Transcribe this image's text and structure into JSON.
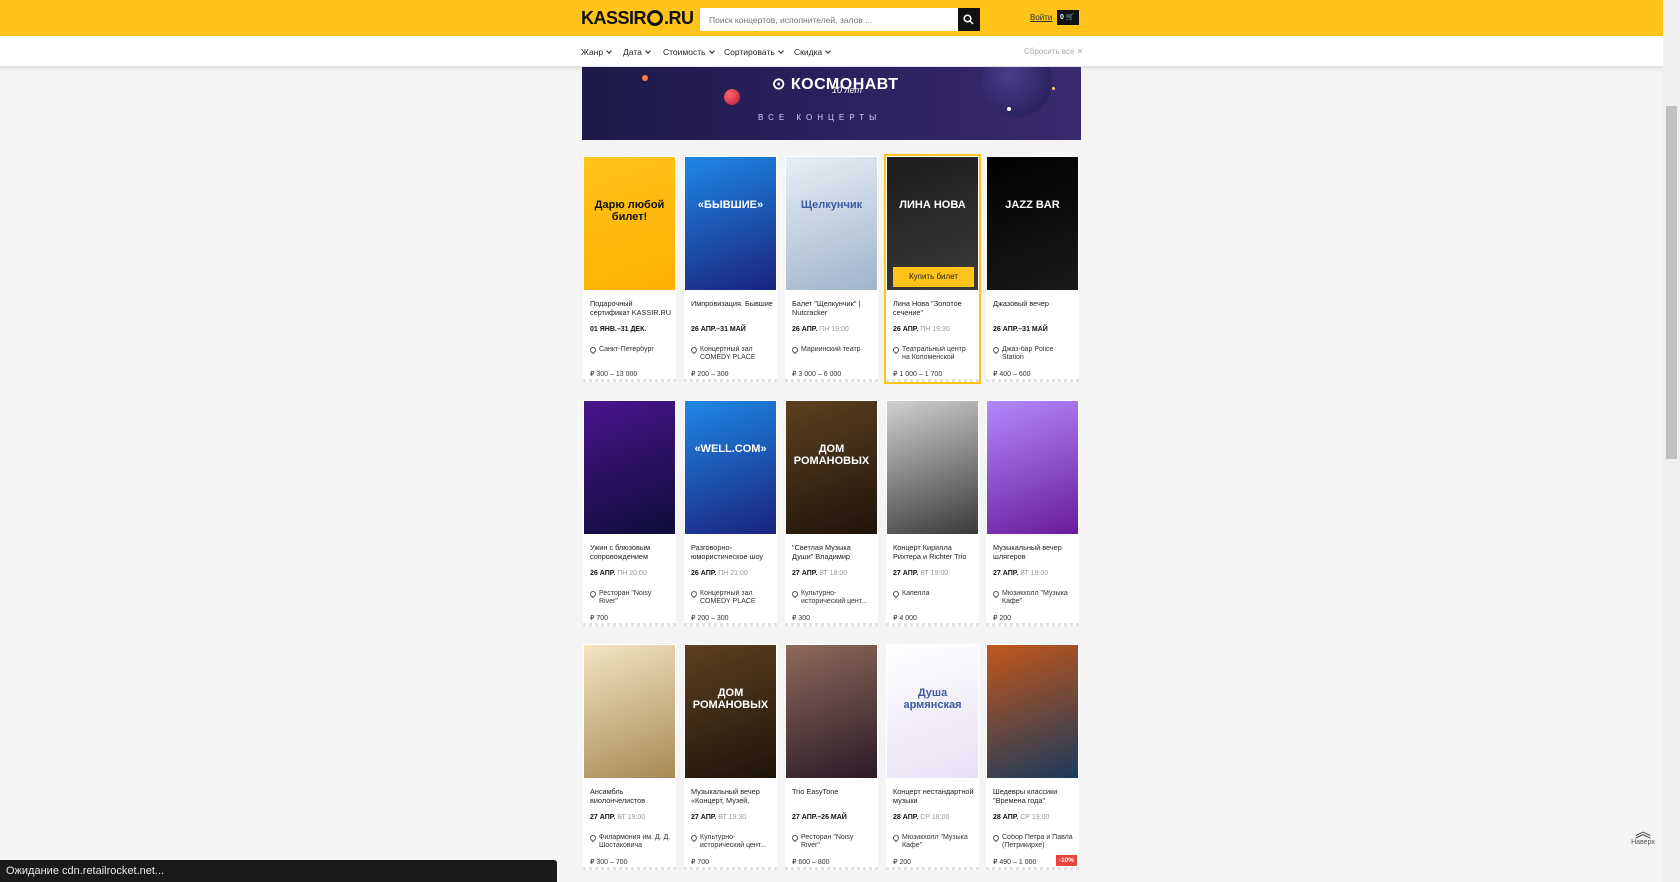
{
  "header": {
    "logo": "KASSIR.RU",
    "logo_left": "KASSIR",
    "logo_right": ".RU",
    "search_placeholder": "Поиск концертов, исполнителей, залов ...",
    "login": "Войти",
    "cart_count": "0"
  },
  "filters": {
    "items": [
      "Жанр",
      "Дата",
      "Стоимость",
      "Сортировать",
      "Скидка"
    ],
    "reset": "Сбросить все"
  },
  "banner": {
    "title": "КОСМОНАВТ",
    "subtitle": "10 лет",
    "link": "ВСЕ КОНЦЕРТЫ"
  },
  "buy_label": "Купить билет",
  "events": [
    {
      "title": "Подарочный сертификат KASSIR.RU",
      "date": "01 ЯНВ.–31 ДЕК.",
      "dow": "",
      "venue": "Санкт-Петербург",
      "price": "₽ 300 – 13 000",
      "img_text": "Дарю любой билет!",
      "colors": [
        "#ffc31a",
        "#ffb000"
      ]
    },
    {
      "title": "Импровизация. Бывшие",
      "date": "26 АПР.–31 МАЙ",
      "dow": "",
      "venue": "Концертный зал COMEDY PLACE",
      "price": "₽ 200 – 300",
      "img_text": "«БЫВШИЕ»",
      "colors": [
        "#1e88e5",
        "#1a237e"
      ]
    },
    {
      "title": "Балет \"Щелкунчик\" | Nutcracker",
      "date": "26 АПР.",
      "dow": "ПН 19:00",
      "venue": "Мариинский театр",
      "price": "₽ 3 000 – 6 000",
      "img_text": "Щелкунчик",
      "colors": [
        "#e8eef5",
        "#9fb4cc"
      ]
    },
    {
      "title": "Лина Нова \"Золотое сечение\"",
      "date": "26 АПР.",
      "dow": "ПН 19:30",
      "venue": "Театральный центр на Коломенской",
      "price": "₽ 1 000 – 1 700",
      "img_text": "ЛИНА НОВА",
      "colors": [
        "#1c1c1c",
        "#3b3b3b"
      ]
    },
    {
      "title": "Джазовый вечер",
      "date": "26 АПР.–31 МАЙ",
      "dow": "",
      "venue": "Джаз-бар Police Station",
      "price": "₽ 400 – 600",
      "img_text": "JAZZ BAR",
      "colors": [
        "#000000",
        "#1a1a1a"
      ]
    },
    {
      "title": "Ужин с блюзовым сопровождением",
      "date": "26 АПР.",
      "dow": "ПН 20:00",
      "venue": "Ресторан \"Noisy River\"",
      "price": "₽ 700",
      "img_text": "",
      "colors": [
        "#4a148c",
        "#0d0d3a"
      ]
    },
    {
      "title": "Разговорно-юмористическое шоу",
      "date": "26 АПР.",
      "dow": "ПН 21:00",
      "venue": "Концертный зал COMEDY PLACE",
      "price": "₽ 200 – 300",
      "img_text": "«WELL.COM»",
      "colors": [
        "#1e88e5",
        "#1a237e"
      ]
    },
    {
      "title": "\"Светлая Музыка Души\" Владимир",
      "date": "27 АПР.",
      "dow": "ВТ 18:00",
      "venue": "Культурно-исторический цент...",
      "price": "₽ 300",
      "img_text": "ДОМ РОМАНОВЫХ",
      "colors": [
        "#5d4020",
        "#1f140a"
      ]
    },
    {
      "title": "Концерт Кирилла Рихтера и Richter Trio",
      "date": "27 АПР.",
      "dow": "ВТ 19:00",
      "venue": "Капелла",
      "price": "₽ 4 000",
      "img_text": "",
      "colors": [
        "#d0d0d0",
        "#3a3a3a"
      ]
    },
    {
      "title": "Музыкальный вечер шлягеров",
      "date": "27 АПР.",
      "dow": "ВТ 19:00",
      "venue": "Мюзикхолл \"Музыка Кафе\"",
      "price": "₽ 200",
      "img_text": "",
      "colors": [
        "#b388ff",
        "#6a1b9a"
      ]
    },
    {
      "title": "Ансамбль виолончелистов",
      "date": "27 АПР.",
      "dow": "ВТ 19:00",
      "venue": "Филармония им. Д. Д. Шостаковича",
      "price": "₽ 300 – 700",
      "img_text": "",
      "colors": [
        "#f3e5c0",
        "#a78a55"
      ]
    },
    {
      "title": "Музыкальный вечер «Концерт, Музей,",
      "date": "27 АПР.",
      "dow": "ВТ 19:30",
      "venue": "Культурно-исторический цент...",
      "price": "₽ 700",
      "img_text": "ДОМ РОМАНОВЫХ",
      "colors": [
        "#5d4020",
        "#1f140a"
      ]
    },
    {
      "title": "Trio EasyTone",
      "date": "27 АПР.–26 МАЙ",
      "dow": "",
      "venue": "Ресторан \"Noisy River\"",
      "price": "₽ 600 – 800",
      "img_text": "",
      "colors": [
        "#8e6a5a",
        "#2b1a28"
      ]
    },
    {
      "title": "Концерт нестандартной музыки",
      "date": "28 АПР.",
      "dow": "СР 18:00",
      "venue": "Мюзикхолл \"Музыка Кафе\"",
      "price": "₽ 200",
      "img_text": "Душа армянская",
      "colors": [
        "#ffffff",
        "#e8e0f5"
      ]
    },
    {
      "title": "Шедевры классики \"Времена года\"",
      "date": "28 АПР.",
      "dow": "СР 19:00",
      "venue": "Собор Петра и Павла (Петрикирхе)",
      "price": "₽ 490 – 1 000",
      "img_text": "",
      "colors": [
        "#c2571a",
        "#1b3a5c"
      ],
      "discount": "-10%"
    }
  ],
  "to_top": "Наверх",
  "status": "Ожидание cdn.retailrocket.net..."
}
